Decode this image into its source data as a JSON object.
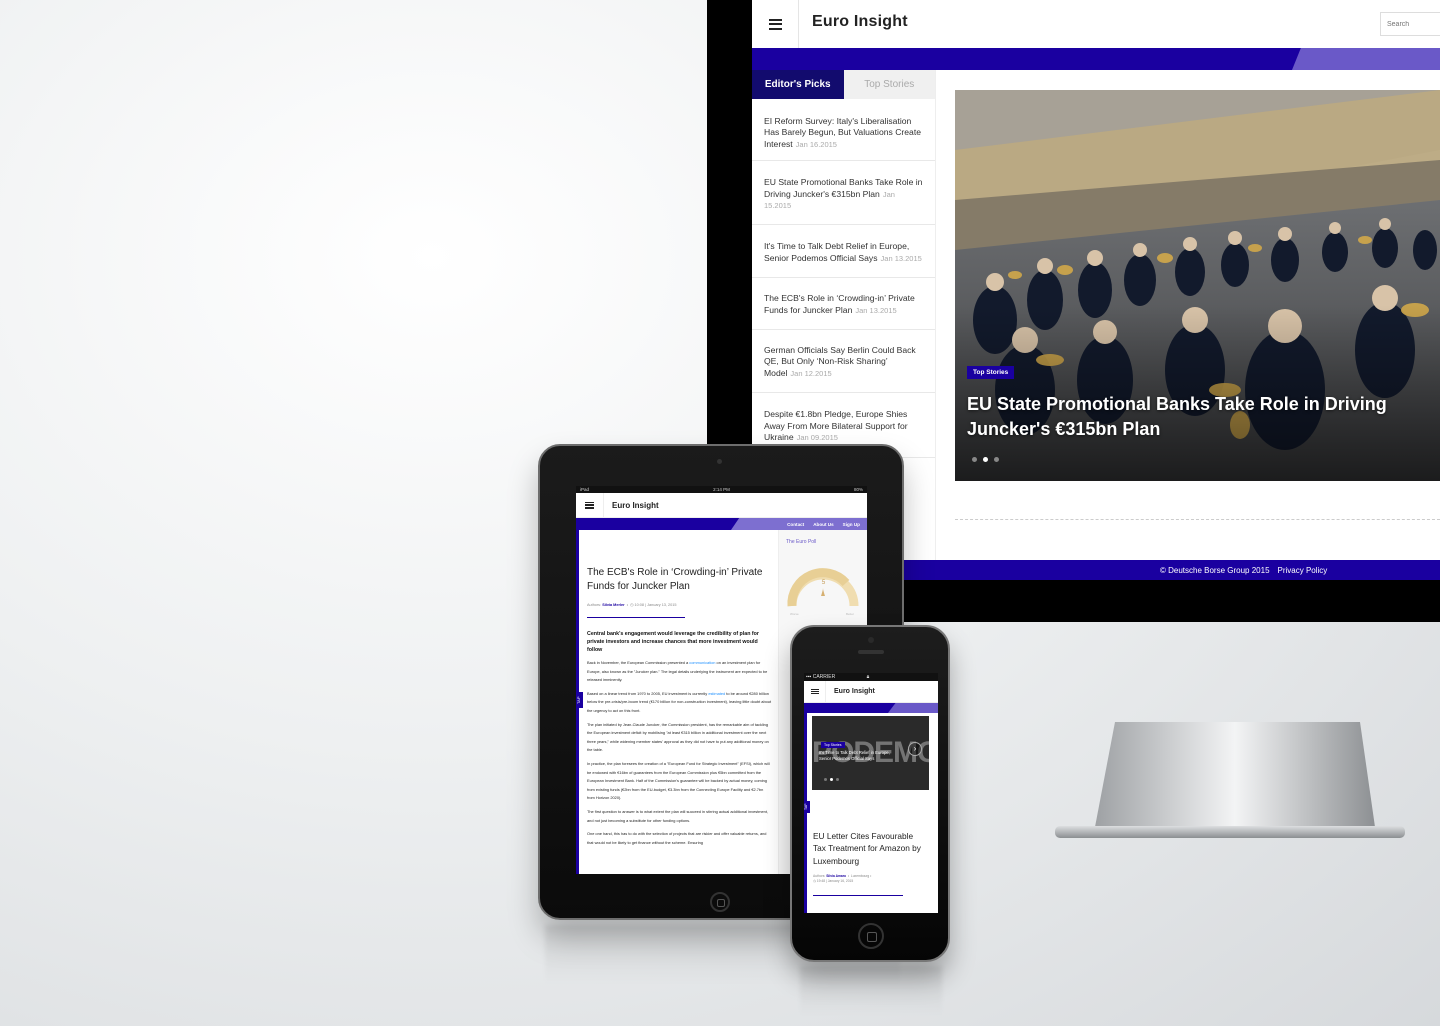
{
  "brand": {
    "name": "Euro Insight",
    "accent_color": "#1a00a0",
    "accent_light": "#6a59c8",
    "dark_tab_color": "#120b6e"
  },
  "desktop": {
    "header": {
      "menu_icon": "hamburger-icon",
      "search_placeholder": "Search"
    },
    "sidebar": {
      "tabs": [
        {
          "label": "Editor's Picks",
          "active": true
        },
        {
          "label": "Top Stories",
          "active": false
        }
      ],
      "items": [
        {
          "title": "EI Reform Survey: Italy's Liberalisation Has Barely Begun, But Valuations Create Interest",
          "date": "Jan 16.2015"
        },
        {
          "title": "EU State Promotional Banks Take Role in Driving Juncker's €315bn Plan",
          "date": "Jan 15.2015"
        },
        {
          "title": "It's Time to Talk Debt Relief in Europe, Senior Podemos Official Says",
          "date": "Jan 13.2015"
        },
        {
          "title": "The ECB's Role in ‘Crowding-in’ Private Funds for Juncker Plan",
          "date": "Jan 13.2015"
        },
        {
          "title": "German Officials Say Berlin Could Back QE, But Only ‘Non-Risk Sharing’ Model",
          "date": "Jan 12.2015"
        },
        {
          "title": "Despite €1.8bn Pledge, Europe Shies Away From More Bilateral Support for Ukraine",
          "date": "Jan 09.2015"
        }
      ]
    },
    "hero": {
      "label": "Top Stories",
      "title": "EU State Promotional Banks Take Role in Driving Juncker's €315bn Plan",
      "slide_count": 3,
      "active_slide": 2
    },
    "footer": {
      "copyright": "© Deutsche Borse Group 2015",
      "privacy": "Privacy Policy"
    }
  },
  "tablet": {
    "status": {
      "left": "iPad",
      "center": "2:14 PM",
      "right": "80%"
    },
    "nav_links": [
      "Contact",
      "About Us",
      "Sign Up"
    ],
    "tap_label": "TAP",
    "article": {
      "title": "The ECB's Role in ‘Crowding-in’ Private Funds for Juncker Plan",
      "author_prefix": "Authors:",
      "author": "Silvia Merler",
      "time": "10:08 | January 13, 2015",
      "lead": "Central bank's engagement would leverage the credibility of plan for private investors and increase chances that more investment would follow",
      "p1_a": "Back in November, the European Commission presented a ",
      "p1_link": "communication",
      "p1_b": " on an investment plan for Europe, also known as the \"Juncker plan.\" The legal details underlying the instrument are expected to be released imminently.",
      "p2_a": "Based on a linear trend from 1970 to 2005, EU investment is currently ",
      "p2_link": "estimated",
      "p2_b": " to be around €280 billion below the pre-crisis/pre-boom trend (€170 billion for non-construction investment), leaving little doubt about the urgency to act on this front.",
      "p3": "The plan initiated by Jean-Claude Juncker, the Commission president, has the remarkable aim of tackling the European investment deficit by mobilising \"at least €315 billion in additional investment over the next three years,\" while widening member states' approval as they did not have to put any additional money on the table.",
      "p4": "In practice, the plan foresees the creation of a \"European Fund for Strategic Investment\" (EFSI), which will be endowed with €16bn of guarantees from the European Commission plus €5bn committed from the European Investment Bank. Half of the Commission's guarantee will be backed by actual money, coming from existing funds (€2bn from the EU-budget, €3.3bn from the Connecting Europe Facility and €2.7bn from Horizon 2020).",
      "p5": "The first question to answer is to what extent the plan will succeed in stirring actual additional investment, and not just becoming a substitute for other funding options.",
      "p6": "One one hand, this has to do with the selection of projects that are riskier and offer valuable returns, and that would not be likely to get finance without the scheme. Ensuring"
    },
    "poll": {
      "title": "The Euro Poll",
      "value": 5,
      "min_label": "Worse",
      "max_label": "Better"
    }
  },
  "phone": {
    "status": "CARRIER",
    "tap_label": "TAP",
    "hero": {
      "background_word": "PODEMO",
      "label": "Top Stories",
      "title": "It's Time to Talk Debt Relief in Europe, Senior Podemos Official Says",
      "slide_count": 3,
      "active_slide": 2
    },
    "article": {
      "title": "EU Letter Cites Favourable Tax Treatment for Amazon by Luxembourg",
      "author_prefix": "Authors:",
      "author": "Silvia Amaro",
      "tag": "Luxembourg",
      "time": "19:48 | January 16, 2015"
    }
  }
}
